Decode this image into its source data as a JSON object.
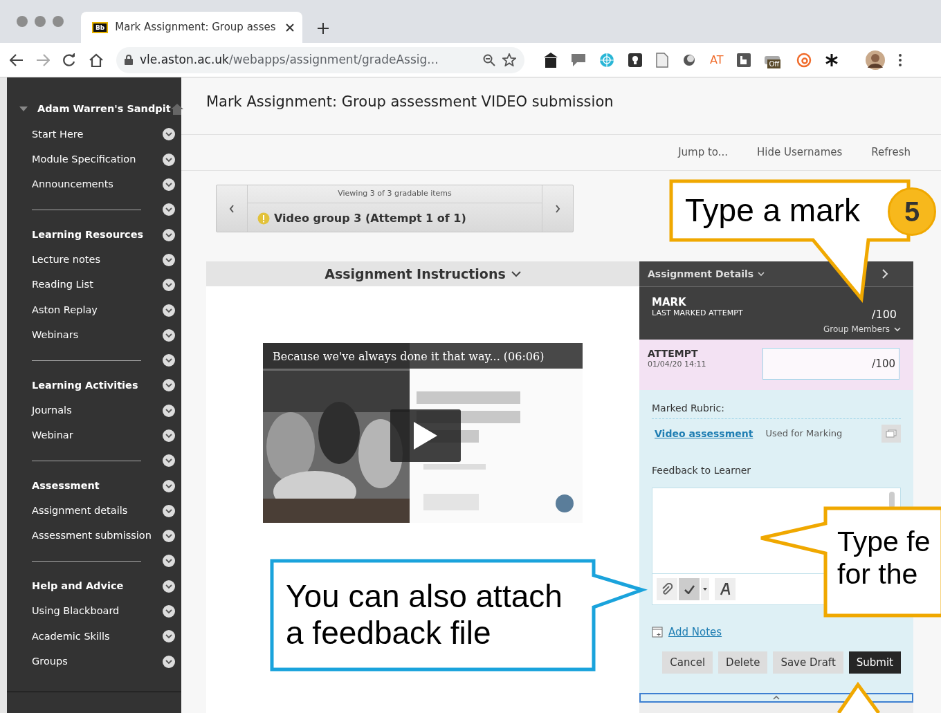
{
  "browser": {
    "tab_icon": "Bb",
    "tab_title": "Mark Assignment: Group asses",
    "url_host": "vle.aston.ac.uk",
    "url_path": "/webapps/assignment/gradeAssig...",
    "extension_label": "AT",
    "extension_badge": "Off"
  },
  "course": {
    "title": "Adam Warren's Sandpit",
    "expanded": true
  },
  "menu": [
    {
      "kind": "link",
      "label": "Start Here"
    },
    {
      "kind": "link",
      "label": "Module Specification"
    },
    {
      "kind": "link",
      "label": "Announcements"
    },
    {
      "kind": "divider"
    },
    {
      "kind": "heading",
      "label": "Learning Resources"
    },
    {
      "kind": "link",
      "label": "Lecture notes"
    },
    {
      "kind": "link",
      "label": "Reading List"
    },
    {
      "kind": "link",
      "label": "Aston Replay"
    },
    {
      "kind": "link",
      "label": "Webinars"
    },
    {
      "kind": "divider"
    },
    {
      "kind": "heading",
      "label": "Learning Activities"
    },
    {
      "kind": "link",
      "label": "Journals"
    },
    {
      "kind": "link",
      "label": "Webinar"
    },
    {
      "kind": "divider"
    },
    {
      "kind": "heading",
      "label": "Assessment"
    },
    {
      "kind": "link",
      "label": "Assignment details"
    },
    {
      "kind": "link",
      "label": "Assessment submission"
    },
    {
      "kind": "divider"
    },
    {
      "kind": "heading",
      "label": "Help and Advice"
    },
    {
      "kind": "link",
      "label": "Using Blackboard"
    },
    {
      "kind": "link",
      "label": "Academic Skills"
    },
    {
      "kind": "link",
      "label": "Groups"
    }
  ],
  "page_title": "Mark Assignment: Group assessment VIDEO submission",
  "actions": [
    "Jump to...",
    "Hide Usernames",
    "Refresh"
  ],
  "navigator": {
    "caption": "Viewing 3 of 3 gradable items",
    "item": "Video group 3 (Attempt 1 of 1)"
  },
  "instructions": {
    "heading": "Assignment Instructions",
    "video_title": "Because we've always done it that way... (06:06)"
  },
  "details": {
    "heading": "Assignment Details",
    "mark_label": "MARK",
    "mark_sub": "LAST MARKED ATTEMPT",
    "mark_value": "/100",
    "group_members": "Group Members",
    "attempt_label": "ATTEMPT",
    "attempt_date": "01/04/20 14:11",
    "attempt_out_of": "/100",
    "rubric_label": "Marked Rubric:",
    "rubric_link": "Video assessment",
    "rubric_status": "Used for Marking",
    "feedback_label": "Feedback to Learner",
    "add_notes": "Add Notes",
    "buttons": [
      {
        "label": "Cancel",
        "kind": "secondary"
      },
      {
        "label": "Delete",
        "kind": "secondary"
      },
      {
        "label": "Save Draft",
        "kind": "secondary"
      },
      {
        "label": "Submit",
        "kind": "primary"
      }
    ]
  },
  "callouts": [
    {
      "lines": [
        "Type a mark"
      ],
      "color": "#f0a800",
      "step": "5"
    },
    {
      "lines": [
        "You can also attach",
        "a feedback file"
      ],
      "color": "#1aa3dc"
    },
    {
      "lines": [
        "Type fe",
        "for the"
      ],
      "color": "#f0a800"
    },
    {
      "color": "#f0a800"
    }
  ]
}
